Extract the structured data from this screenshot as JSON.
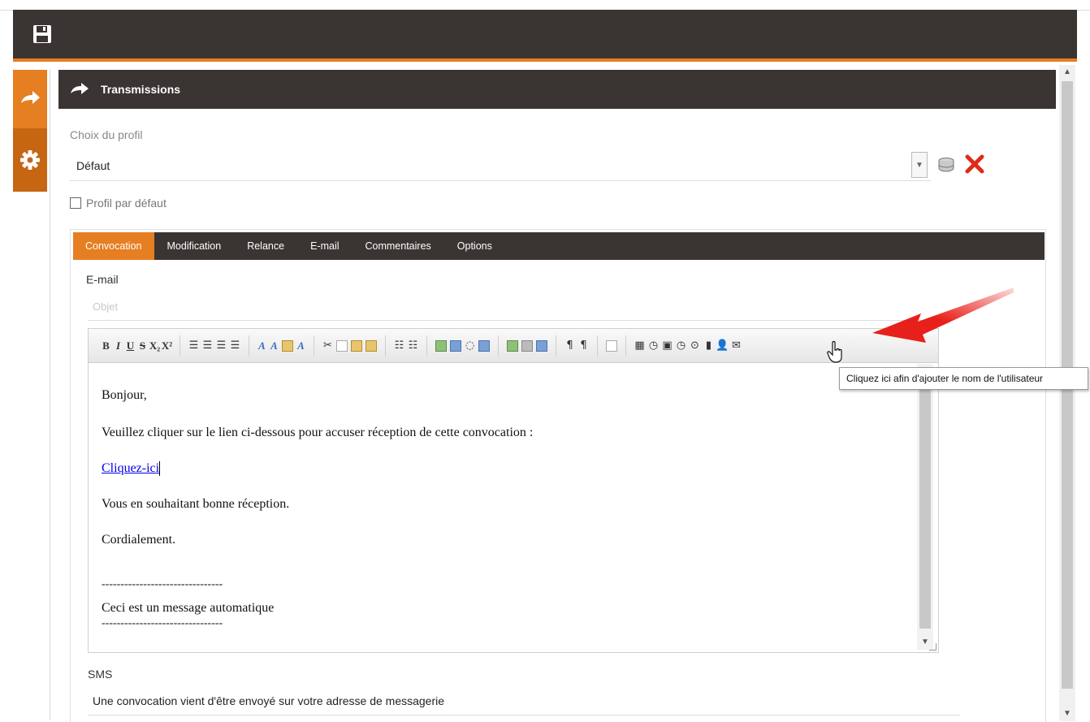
{
  "panel": {
    "title": "Transmissions"
  },
  "profile": {
    "label": "Choix du profil",
    "selected": "Défaut",
    "default_checkbox_label": "Profil par défaut",
    "default_checked": false
  },
  "tabs": [
    {
      "label": "Convocation",
      "active": true
    },
    {
      "label": "Modification",
      "active": false
    },
    {
      "label": "Relance",
      "active": false
    },
    {
      "label": "E-mail",
      "active": false
    },
    {
      "label": "Commentaires",
      "active": false
    },
    {
      "label": "Options",
      "active": false
    }
  ],
  "email": {
    "label": "E-mail",
    "subject_placeholder": "Objet",
    "subject_value": ""
  },
  "toolbar": {
    "format": [
      "B",
      "I",
      "U",
      "S",
      "X₂",
      "X²"
    ],
    "tooltip": "Cliquez ici afin d'ajouter le nom de l'utilisateur"
  },
  "body": {
    "greeting": "Bonjour,",
    "line1": "Veuillez cliquer sur le lien ci-dessous pour accuser réception de cette convocation :",
    "link": "Cliquez-ici",
    "line2": "Vous en souhaitant bonne réception.",
    "closing": "Cordialement.",
    "separator": "--------------------------------",
    "auto_message": "Ceci est un message automatique"
  },
  "sms": {
    "label": "SMS",
    "value": "Une convocation vient d'être envoyé sur votre adresse de messagerie"
  },
  "colors": {
    "accent": "#e67e22",
    "dark_bar": "#3a3532",
    "delete": "#e02a1a",
    "annotation_arrow": "#e8201b"
  },
  "icons": {
    "save": "save-icon",
    "panel": "arrow-right-icon",
    "settings": "gear-icon",
    "delete": "close-icon",
    "user": "user-icon",
    "mail": "envelope-icon"
  }
}
